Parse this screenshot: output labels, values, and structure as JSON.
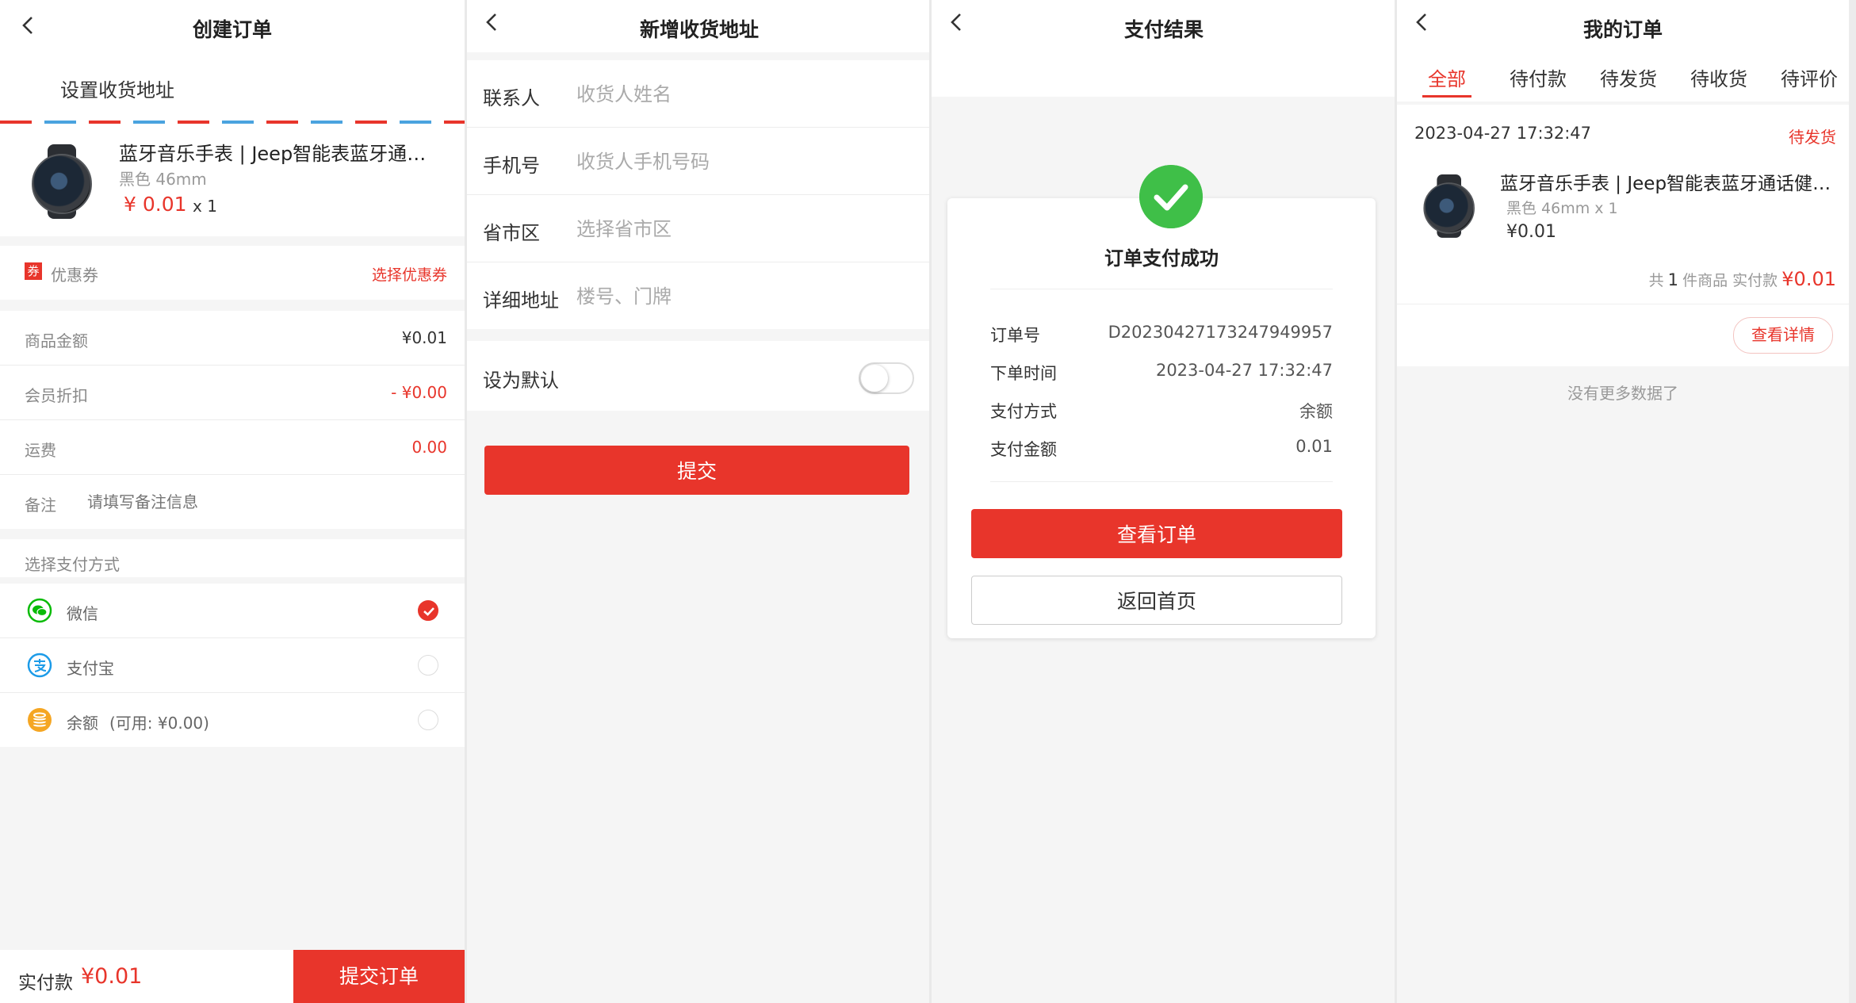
{
  "screens": {
    "create_order": {
      "title": "创建订单",
      "set_address": "设置收货地址",
      "goods": {
        "name": "蓝牙音乐手表 | Jeep智能表蓝牙通话健康手表",
        "spec": "黑色 46mm",
        "price": "¥ 0.01",
        "qty": "x 1"
      },
      "coupon": {
        "icon_text": "券",
        "label": "优惠券",
        "action": "选择优惠券"
      },
      "fees": [
        {
          "label": "商品金额",
          "value": "¥0.01",
          "color": "#333333"
        },
        {
          "label": "会员折扣",
          "value": "- ¥0.00",
          "color": "#e8352b"
        },
        {
          "label": "运费",
          "value": "0.00",
          "color": "#e8352b"
        }
      ],
      "remark": {
        "label": "备注",
        "placeholder": "请填写备注信息"
      },
      "pay_method_title": "选择支付方式",
      "pay_methods": [
        {
          "label": "微信",
          "icon": "wechat-icon",
          "color": "#09bb07",
          "selected": true
        },
        {
          "label": "支付宝",
          "icon": "alipay-icon",
          "color": "#1c9be8",
          "selected": false
        },
        {
          "label": "余额",
          "extra": "(可用: ¥0.00)",
          "icon": "balance-icon",
          "color": "#f5a623",
          "selected": false
        }
      ],
      "bottom": {
        "label": "实付款",
        "amount": "¥0.01",
        "submit": "提交订单"
      }
    },
    "new_address": {
      "title": "新增收货地址",
      "fields": [
        {
          "label": "联系人",
          "placeholder": "收货人姓名"
        },
        {
          "label": "手机号",
          "placeholder": "收货人手机号码"
        },
        {
          "label": "省市区",
          "placeholder": "选择省市区"
        },
        {
          "label": "详细地址",
          "placeholder": "楼号、门牌"
        }
      ],
      "default_label": "设为默认",
      "submit": "提交"
    },
    "pay_result": {
      "title": "支付结果",
      "status": "订单支付成功",
      "info": [
        {
          "label": "订单号",
          "value": "D20230427173247949957"
        },
        {
          "label": "下单时间",
          "value": "2023-04-27 17:32:47"
        },
        {
          "label": "支付方式",
          "value": "余额"
        },
        {
          "label": "支付金额",
          "value": "0.01"
        }
      ],
      "view_order": "查看订单",
      "back_home": "返回首页"
    },
    "my_orders": {
      "title": "我的订单",
      "tabs": [
        "全部",
        "待付款",
        "待发货",
        "待收货",
        "待评价"
      ],
      "order": {
        "time": "2023-04-27 17:32:47",
        "status": "待发货",
        "name": "蓝牙音乐手表 | Jeep智能表蓝牙通话健康手表",
        "spec": "黑色 46mm x 1",
        "price": "¥0.01",
        "summary_prefix": "共",
        "count": "1",
        "summary_mid": "件商品 实付款",
        "total": "¥0.01",
        "detail_btn": "查看详情"
      },
      "no_more": "没有更多数据了"
    }
  },
  "colors": {
    "accent": "#e8352b",
    "success": "#3fbf48"
  }
}
